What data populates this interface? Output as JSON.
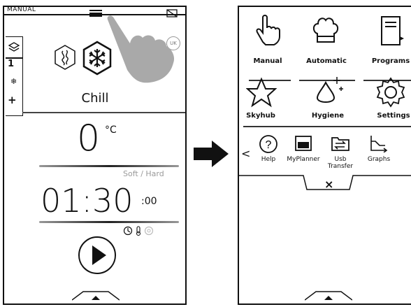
{
  "left_screen": {
    "mode_label": "MANUAL",
    "language_badge": "UK",
    "side_tabs": [
      "1",
      "+"
    ],
    "program_name": "Chill",
    "temperature": {
      "value": "0",
      "unit": "°C"
    },
    "temp_mode": "Soft / Hard",
    "time": {
      "main": "01:30",
      "seconds": ":00"
    }
  },
  "right_screen": {
    "row1": [
      "Manual",
      "Automatic",
      "Programs"
    ],
    "row2": [
      "Skyhub",
      "Hygiene",
      "Settings"
    ],
    "tools": [
      {
        "label": "Help"
      },
      {
        "label": "MyPlanner"
      },
      {
        "label": "Usb\nTransfer"
      },
      {
        "label": "Graphs"
      }
    ],
    "close_label": "×",
    "prev_label": "<"
  },
  "colors": {
    "ink": "#111111",
    "hand_shadow": "#a9a9a9",
    "muted": "#9a9a9a"
  }
}
